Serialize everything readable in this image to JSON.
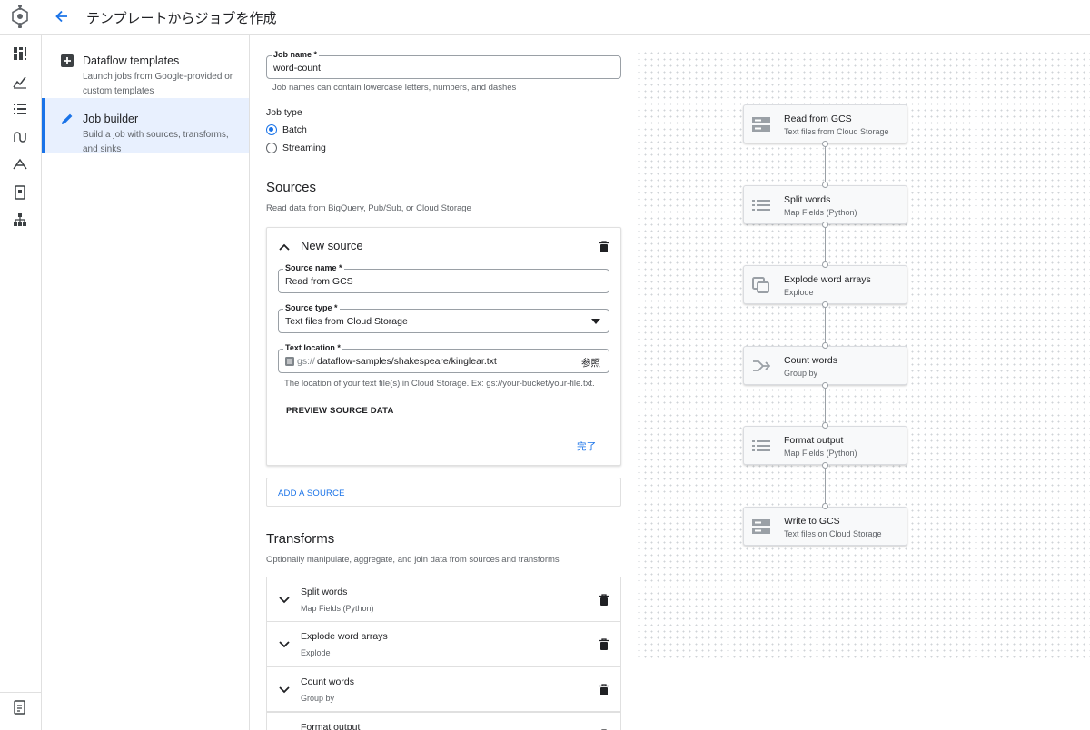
{
  "header": {
    "title": "テンプレートからジョブを作成"
  },
  "left_panel": {
    "items": [
      {
        "title": "Dataflow templates",
        "desc": "Launch jobs from Google-provided or custom templates"
      },
      {
        "title": "Job builder",
        "desc": "Build a job with sources, transforms, and sinks"
      }
    ]
  },
  "form": {
    "job_name": {
      "label": "Job name *",
      "value": "word-count",
      "hint": "Job names can contain lowercase letters, numbers, and dashes"
    },
    "job_type": {
      "label": "Job type",
      "options": [
        "Batch",
        "Streaming"
      ],
      "selected": "Batch"
    },
    "sources": {
      "heading": "Sources",
      "desc": "Read data from BigQuery, Pub/Sub, or Cloud Storage",
      "card": {
        "title": "New source",
        "source_name": {
          "label": "Source name *",
          "value": "Read from GCS"
        },
        "source_type": {
          "label": "Source type *",
          "value": "Text files from Cloud Storage"
        },
        "text_location": {
          "label": "Text location *",
          "prefix": "gs://",
          "value": "dataflow-samples/shakespeare/kinglear.txt",
          "browse": "参照",
          "hint": "The location of your text file(s) in Cloud Storage. Ex: gs://your-bucket/your-file.txt."
        },
        "preview": "PREVIEW SOURCE DATA",
        "done": "完了"
      },
      "add": "ADD A SOURCE"
    },
    "transforms": {
      "heading": "Transforms",
      "desc": "Optionally manipulate, aggregate, and join data from sources and transforms",
      "items": [
        {
          "name": "Split words",
          "type": "Map Fields (Python)"
        },
        {
          "name": "Explode word arrays",
          "type": "Explode"
        },
        {
          "name": "Count words",
          "type": "Group by"
        },
        {
          "name": "Format output",
          "type": ""
        }
      ]
    }
  },
  "graph": {
    "nodes": [
      {
        "title": "Read from GCS",
        "sub": "Text files from Cloud Storage",
        "icon": "storage-icon"
      },
      {
        "title": "Split words",
        "sub": "Map Fields (Python)",
        "icon": "list-icon"
      },
      {
        "title": "Explode word arrays",
        "sub": "Explode",
        "icon": "explode-icon"
      },
      {
        "title": "Count words",
        "sub": "Group by",
        "icon": "merge-icon"
      },
      {
        "title": "Format output",
        "sub": "Map Fields (Python)",
        "icon": "list-icon"
      },
      {
        "title": "Write to GCS",
        "sub": "Text files on Cloud Storage",
        "icon": "storage-icon"
      }
    ]
  },
  "colors": {
    "accent": "#1a73e8",
    "border": "#e0e0e0",
    "active_bg": "#e8f0fe"
  }
}
